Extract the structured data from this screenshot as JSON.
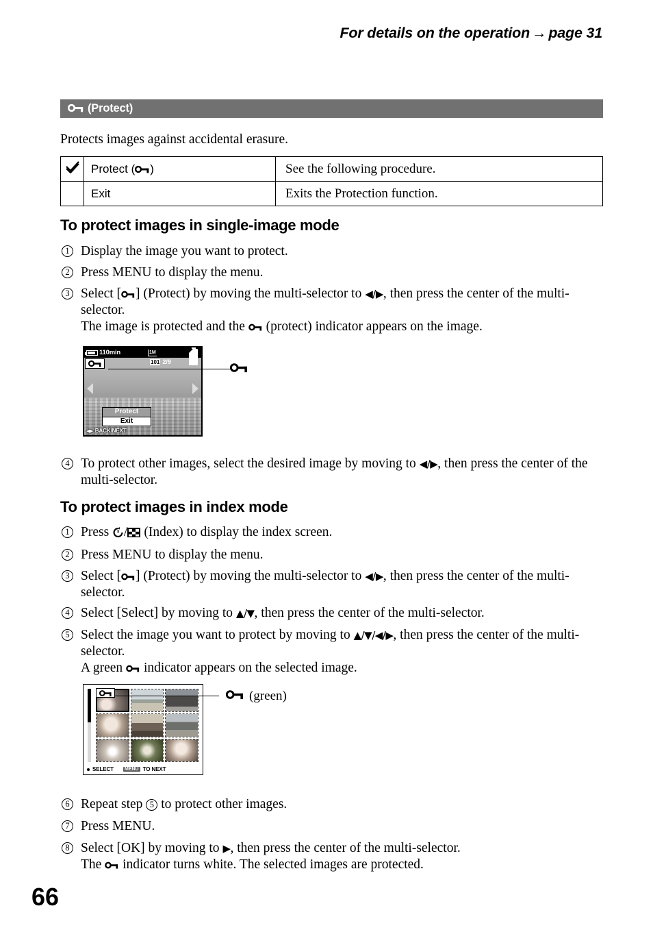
{
  "running_head": {
    "text": "For details on the operation",
    "arrow": "→",
    "page_ref": "page 31"
  },
  "section": {
    "icon": "protect-key-icon",
    "title": "(Protect)",
    "intro": "Protects images against accidental erasure."
  },
  "options_table": {
    "rows": [
      {
        "check": "checkmark-icon",
        "name_prefix": "Protect (",
        "name_suffix": ")",
        "description": "See the following procedure."
      },
      {
        "check": "",
        "name_prefix": "Exit",
        "name_suffix": "",
        "description": "Exits the Protection function."
      }
    ]
  },
  "single_image_mode": {
    "heading": "To protect images in single-image mode",
    "steps": [
      {
        "num": "1",
        "lines": [
          "Display the image you want to protect."
        ]
      },
      {
        "num": "2",
        "lines": [
          "Press MENU to display the menu."
        ]
      },
      {
        "num": "3",
        "lines": [
          "Select [␣] (Protect) by moving the multi-selector to ◀/▶, then press the center of the multi-selector.",
          "The image is protected and the ␣ (protect) indicator appears on the image."
        ]
      },
      {
        "num": "4",
        "lines": [
          "To protect other images, select the desired image by moving to ◀/▶, then press the center of the multi-selector."
        ]
      }
    ],
    "step3_part1_a": "Select [",
    "step3_part1_b": "] (Protect) by moving the multi-selector to ",
    "step3_dirs": "◀/▶",
    "step3_part1_c": ", then press the center of the multi-selector.",
    "step3_part2_a": "The image is protected and the ",
    "step3_part2_b": " (protect) indicator appears on the image.",
    "step4_a": "To protect other images, select the desired image by moving to ",
    "step4_dirs": "◀/▶",
    "step4_b": ", then press the center of the multi-selector."
  },
  "lcd_screen": {
    "battery_time": "110min",
    "image_size": "1M",
    "folder": "101",
    "counter": "2/9",
    "protect_badge": "protect-key-icon",
    "menu_items": [
      {
        "label": "Protect",
        "selected": true
      },
      {
        "label": "Exit",
        "selected": false
      }
    ],
    "bottom_hint": "BACK/NEXT",
    "bottom_hint_dirs": "◀▶",
    "callout_icon": "protect-key-icon"
  },
  "index_mode": {
    "heading": "To protect images in index mode",
    "step1_a": "Press ",
    "step1_icons": [
      "self-timer-icon",
      "index-grid-icon"
    ],
    "step1_b": " (Index) to display the index screen.",
    "step2": "Press MENU to display the menu.",
    "step3_a": "Select [",
    "step3_b": "] (Protect) by moving the multi-selector to ",
    "step3_dirs": "◀/▶",
    "step3_c": ", then press the center of the multi-selector.",
    "step4_a": "Select [Select] by moving to ",
    "step4_dirs": "▲/▼",
    "step4_b": ", then press the center of the multi-selector.",
    "step5_a": "Select the image you want to protect by moving to ",
    "step5_dirs": "▲/▼/◀/▶",
    "step5_b": ", then press the center of the multi-selector.",
    "step5_c1": "A green ",
    "step5_c2": " indicator appears on the selected image.",
    "step6_a": "Repeat step ",
    "step6_ref": "5",
    "step6_b": " to protect other images.",
    "step7": "Press MENU.",
    "step8_a": "Select [OK] by moving to ",
    "step8_dirs": "▶",
    "step8_b": ", then press the center of the multi-selector.",
    "step8_c1": "The ",
    "step8_c2": " indicator turns white. The selected images are protected."
  },
  "index_screen": {
    "select_hint": "SELECT",
    "menu_key": "MENU",
    "next_hint": "TO NEXT",
    "badge_icon": "protect-key-icon",
    "thumbnail_count": 9,
    "selected_thumbnail": 1,
    "callout_label": "(green)",
    "callout_icon": "protect-key-icon"
  },
  "page_number": "66",
  "colors": {
    "section_bar": "#717171",
    "text": "#000000",
    "lcd_background": "#000000"
  }
}
